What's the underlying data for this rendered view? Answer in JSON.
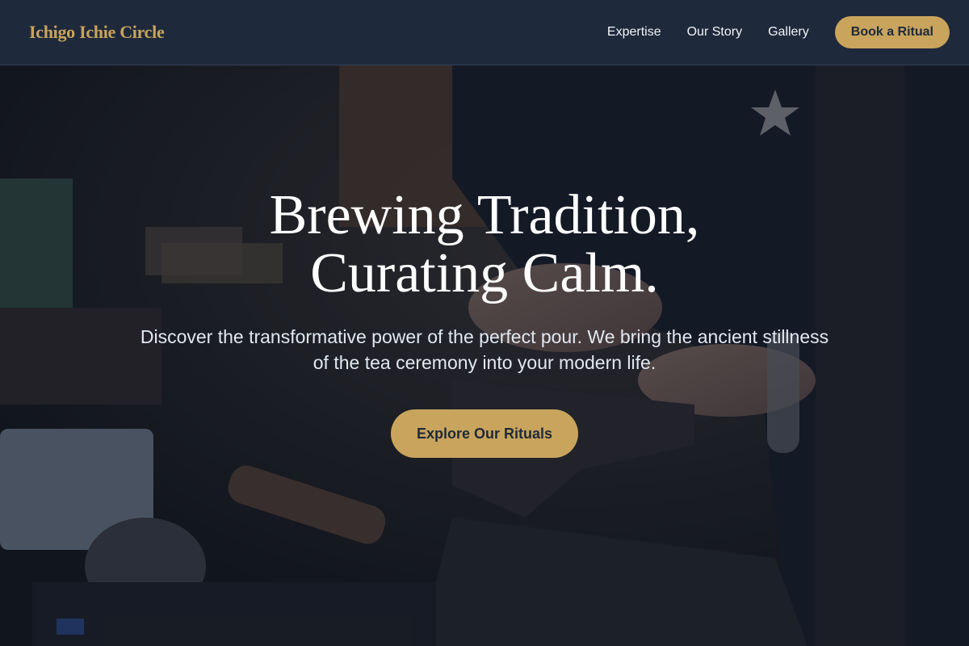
{
  "brand": {
    "name": "Ichigo Ichie Circle"
  },
  "nav": {
    "links": [
      {
        "label": "Expertise"
      },
      {
        "label": "Our Story"
      },
      {
        "label": "Gallery"
      }
    ],
    "cta_label": "Book a Ritual"
  },
  "hero": {
    "title_line1": "Brewing Tradition,",
    "title_line2": "Curating Calm.",
    "subtitle": "Discover the transformative power of the perfect pour. We bring the ancient stillness of the tea ceremony into your modern life.",
    "cta_label": "Explore Our Rituals",
    "background_image": "dark workshop photo with hands, tools and jewelry"
  },
  "colors": {
    "navbar_bg": "#1e293b",
    "accent_gold": "#c9a45c",
    "overlay": "#0f172a",
    "text_light": "#e2e8f0"
  }
}
